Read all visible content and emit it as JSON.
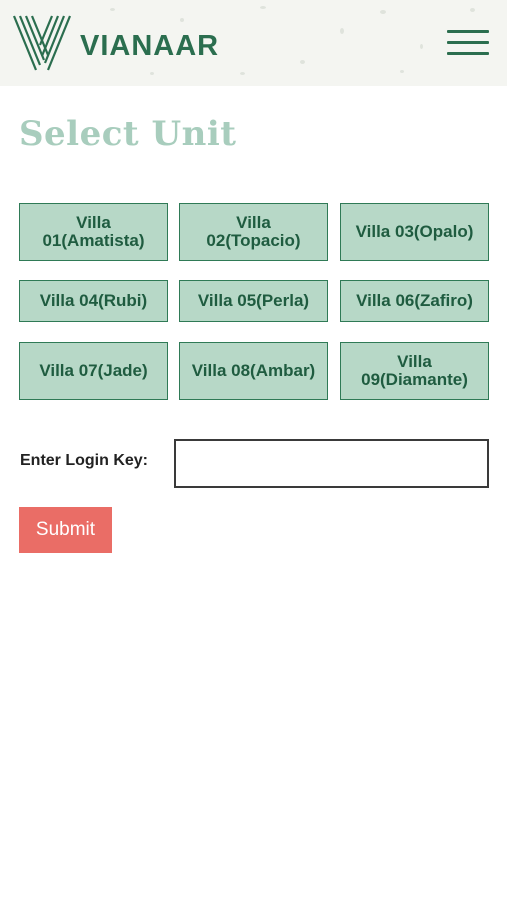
{
  "header": {
    "brand": "VIANAAR",
    "logo_icon": "vianaar-v-logo-icon",
    "menu_icon": "hamburger-menu-icon",
    "brand_color": "#2b6e4f"
  },
  "page": {
    "title": "Select Unit",
    "title_color": "#a8cdbd"
  },
  "units": [
    {
      "line1": "Villa",
      "line2": "01(Amatista)"
    },
    {
      "line1": "Villa",
      "line2": "02(Topacio)"
    },
    {
      "line1": "Villa 03(Opalo)",
      "line2": ""
    },
    {
      "line1": "Villa 04(Rubi)",
      "line2": ""
    },
    {
      "line1": "Villa 05(Perla)",
      "line2": ""
    },
    {
      "line1": "Villa 06(Zafiro)",
      "line2": ""
    },
    {
      "line1": "Villa 07(Jade)",
      "line2": ""
    },
    {
      "line1": "Villa 08(Ambar)",
      "line2": ""
    },
    {
      "line1": "Villa",
      "line2": "09(Diamante)"
    }
  ],
  "login": {
    "label": "Enter Login Key:",
    "value": "",
    "placeholder": ""
  },
  "submit": {
    "label": "Submit",
    "color": "#ea6d66"
  }
}
